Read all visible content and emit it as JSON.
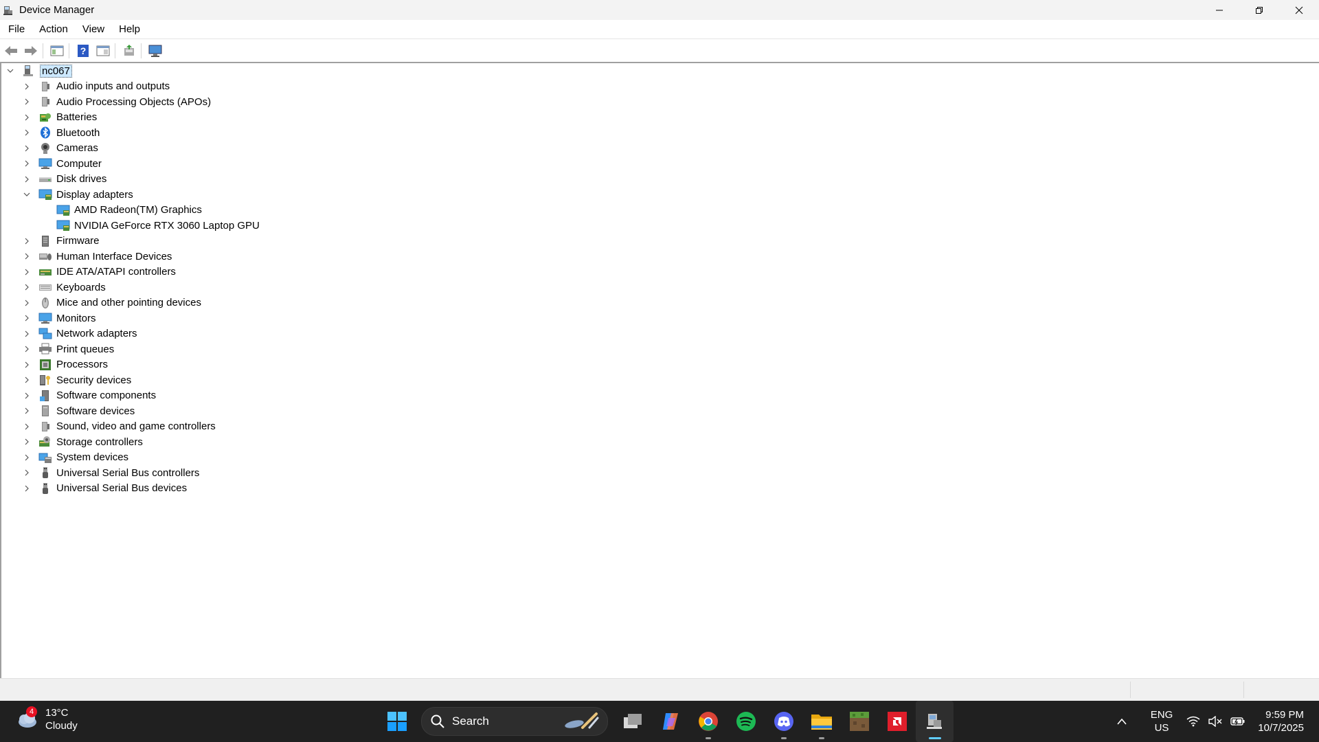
{
  "window": {
    "title": "Device Manager",
    "controls": [
      "minimize",
      "restore",
      "close"
    ]
  },
  "menu": [
    "File",
    "Action",
    "View",
    "Help"
  ],
  "toolbar": {
    "buttons": [
      "back",
      "forward",
      "show-hide-console-tree",
      "help",
      "properties",
      "update-driver",
      "scan-hardware-changes"
    ]
  },
  "tree": {
    "root": "nc067",
    "categories": [
      {
        "label": "Audio inputs and outputs",
        "icon": "speaker-icon",
        "expanded": false
      },
      {
        "label": "Audio Processing Objects (APOs)",
        "icon": "speaker-icon",
        "expanded": false
      },
      {
        "label": "Batteries",
        "icon": "battery-icon",
        "expanded": false
      },
      {
        "label": "Bluetooth",
        "icon": "bluetooth-icon",
        "expanded": false
      },
      {
        "label": "Cameras",
        "icon": "camera-icon",
        "expanded": false
      },
      {
        "label": "Computer",
        "icon": "monitor-icon",
        "expanded": false
      },
      {
        "label": "Disk drives",
        "icon": "disk-icon",
        "expanded": false
      },
      {
        "label": "Display adapters",
        "icon": "display-adapter-icon",
        "expanded": true,
        "children": [
          "AMD Radeon(TM) Graphics",
          "NVIDIA GeForce RTX 3060 Laptop GPU"
        ]
      },
      {
        "label": "Firmware",
        "icon": "firmware-icon",
        "expanded": false
      },
      {
        "label": "Human Interface Devices",
        "icon": "hid-icon",
        "expanded": false
      },
      {
        "label": "IDE ATA/ATAPI controllers",
        "icon": "ide-icon",
        "expanded": false
      },
      {
        "label": "Keyboards",
        "icon": "keyboard-icon",
        "expanded": false
      },
      {
        "label": "Mice and other pointing devices",
        "icon": "mouse-icon",
        "expanded": false
      },
      {
        "label": "Monitors",
        "icon": "monitor-icon",
        "expanded": false
      },
      {
        "label": "Network adapters",
        "icon": "network-icon",
        "expanded": false
      },
      {
        "label": "Print queues",
        "icon": "printer-icon",
        "expanded": false
      },
      {
        "label": "Processors",
        "icon": "processor-icon",
        "expanded": false
      },
      {
        "label": "Security devices",
        "icon": "security-icon",
        "expanded": false
      },
      {
        "label": "Software components",
        "icon": "software-component-icon",
        "expanded": false
      },
      {
        "label": "Software devices",
        "icon": "software-device-icon",
        "expanded": false
      },
      {
        "label": "Sound, video and game controllers",
        "icon": "speaker-icon",
        "expanded": false
      },
      {
        "label": "Storage controllers",
        "icon": "storage-icon",
        "expanded": false
      },
      {
        "label": "System devices",
        "icon": "system-icon",
        "expanded": false
      },
      {
        "label": "Universal Serial Bus controllers",
        "icon": "usb-icon",
        "expanded": false
      },
      {
        "label": "Universal Serial Bus devices",
        "icon": "usb-icon",
        "expanded": false
      }
    ]
  },
  "taskbar": {
    "weather": {
      "temp": "13°C",
      "condition": "Cloudy",
      "badge": "4"
    },
    "search_label": "Search",
    "apps": [
      "windows-start",
      "search",
      "task-view",
      "copilot",
      "chrome",
      "spotify",
      "discord",
      "file-explorer",
      "minecraft",
      "amd-software",
      "device-manager"
    ],
    "language": {
      "lang": "ENG",
      "region": "US"
    },
    "clock": {
      "time": "9:59 PM",
      "date": "10/7/2025"
    }
  },
  "colors": {
    "selection": "#cce8ff",
    "taskbar_bg": "#202020",
    "accent": "#60cdff"
  }
}
